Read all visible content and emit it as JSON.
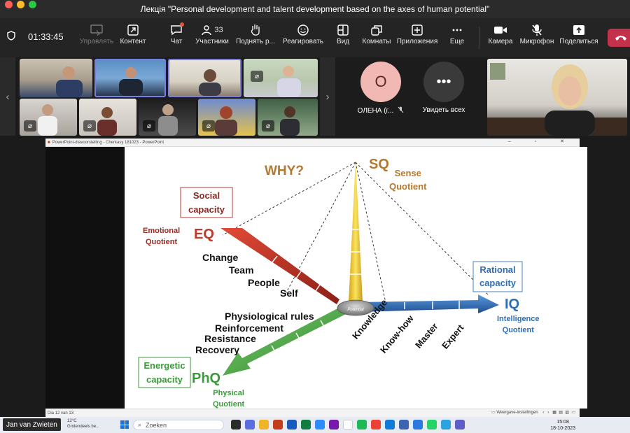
{
  "window": {
    "title": "Лекція \"Personal development and talent development based on the axes of human potential\""
  },
  "toolbar": {
    "timer": "01:33:45",
    "items": [
      {
        "label": "Управлять",
        "icon": "share-control-icon",
        "disabled": true
      },
      {
        "label": "Контент",
        "icon": "content-icon"
      },
      {
        "label": "Чат",
        "icon": "chat-icon"
      },
      {
        "label": "Участники",
        "icon": "people-icon",
        "count": "33"
      },
      {
        "label": "Поднять р...",
        "icon": "raise-hand-icon"
      },
      {
        "label": "Реагировать",
        "icon": "react-icon"
      },
      {
        "label": "Вид",
        "icon": "view-icon"
      },
      {
        "label": "Комнаты",
        "icon": "rooms-icon"
      },
      {
        "label": "Приложения",
        "icon": "apps-icon"
      },
      {
        "label": "Еще",
        "icon": "more-icon"
      },
      {
        "label": "Камера",
        "icon": "camera-icon"
      },
      {
        "label": "Микрофон",
        "icon": "microphone-off-icon"
      },
      {
        "label": "Поделиться",
        "icon": "share-icon"
      }
    ]
  },
  "gallery": {
    "avatar_initial": "O",
    "avatar_name": "ОЛЕНА (г...",
    "see_all_label": "Увидеть всех"
  },
  "presentation": {
    "app_title": "PowerPoint-diavoorstelling - Cherkasy 181023 - PowerPoint",
    "status_slide": "Dia 12 van 13",
    "status_view": "Weergave-instellingen",
    "slide": {
      "why": "WHY?",
      "sq": "SQ",
      "sq_line1": "Sense",
      "sq_line2": "Quotient",
      "social_line1": "Social",
      "social_line2": "capacity",
      "eq": "EQ",
      "eq_line1": "Emotional",
      "eq_line2": "Quotient",
      "eq_words": [
        "Change",
        "Team",
        "People",
        "Self"
      ],
      "rational_line1": "Rational",
      "rational_line2": "capacity",
      "iq": "IQ",
      "iq_line1": "Intelligence",
      "iq_line2": "Quotient",
      "iq_words": [
        "Knowledge",
        "Know-how",
        "Master",
        "Expert"
      ],
      "phq_words": [
        "Physiological rules",
        "Reinforcement",
        "Resistance",
        "Recovery"
      ],
      "energetic_line1": "Energetic",
      "energetic_line2": "capacity",
      "phq": "PhQ",
      "phq_line1": "Physical",
      "phq_line2": "Quotient",
      "center": "Potential"
    }
  },
  "speaker_name": "Jan van Zwieten",
  "taskbar": {
    "weather_temp": "12°C",
    "weather_desc": "Grotendeels be...",
    "search_placeholder": "Zoeken",
    "time": "15:08",
    "date": "18-10-2023"
  },
  "colors": {
    "eq": "#c0392b",
    "sq": "#c99a1d",
    "iq": "#2e6db4",
    "phq": "#3b9b3b",
    "brown": "#b5782f"
  }
}
